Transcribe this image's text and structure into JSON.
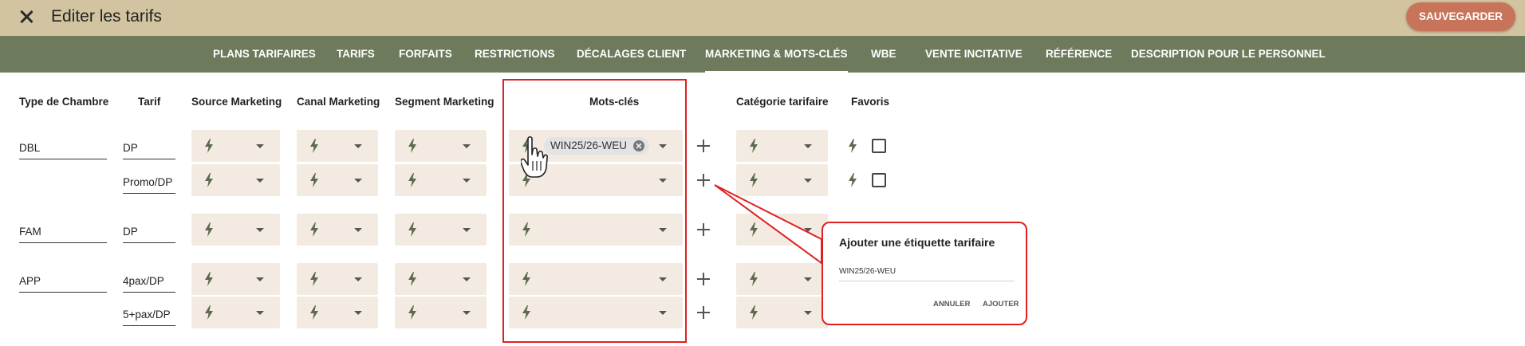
{
  "header": {
    "title": "Editer les tarifs",
    "save_label": "SAUVEGARDER",
    "colors": {
      "topbar": "#d2c4a0",
      "save": "#c8745a",
      "nav": "#6e7a5c"
    }
  },
  "nav": {
    "tabs": [
      {
        "label": "PLANS TARIFAIRES"
      },
      {
        "label": "TARIFS"
      },
      {
        "label": "FORFAITS"
      },
      {
        "label": "RESTRICTIONS"
      },
      {
        "label": "DÉCALAGES CLIENT"
      },
      {
        "label": "MARKETING & MOTS-CLÉS",
        "active": true
      },
      {
        "label": "WBE"
      },
      {
        "label": "VENTE INCITATIVE"
      },
      {
        "label": "RÉFÉRENCE"
      },
      {
        "label": "DESCRIPTION POUR LE PERSONNEL"
      }
    ]
  },
  "table": {
    "headers": {
      "room_type": "Type de Chambre",
      "rate": "Tarif",
      "source": "Source Marketing",
      "channel": "Canal Marketing",
      "segment": "Segment Marketing",
      "keywords": "Mots-clés",
      "category": "Catégorie tarifaire",
      "favorites": "Favoris"
    },
    "room_types": [
      "DBL",
      "FAM",
      "APP"
    ],
    "rates": [
      "DP",
      "Promo/DP",
      "DP",
      "4pax/DP",
      "5+pax/DP"
    ],
    "keyword_chip": "WIN25/26-WEU"
  },
  "dialog": {
    "title": "Ajouter une étiquette tarifaire",
    "input_value": "WIN25/26-WEU",
    "cancel": "ANNULER",
    "add": "AJOUTER"
  }
}
